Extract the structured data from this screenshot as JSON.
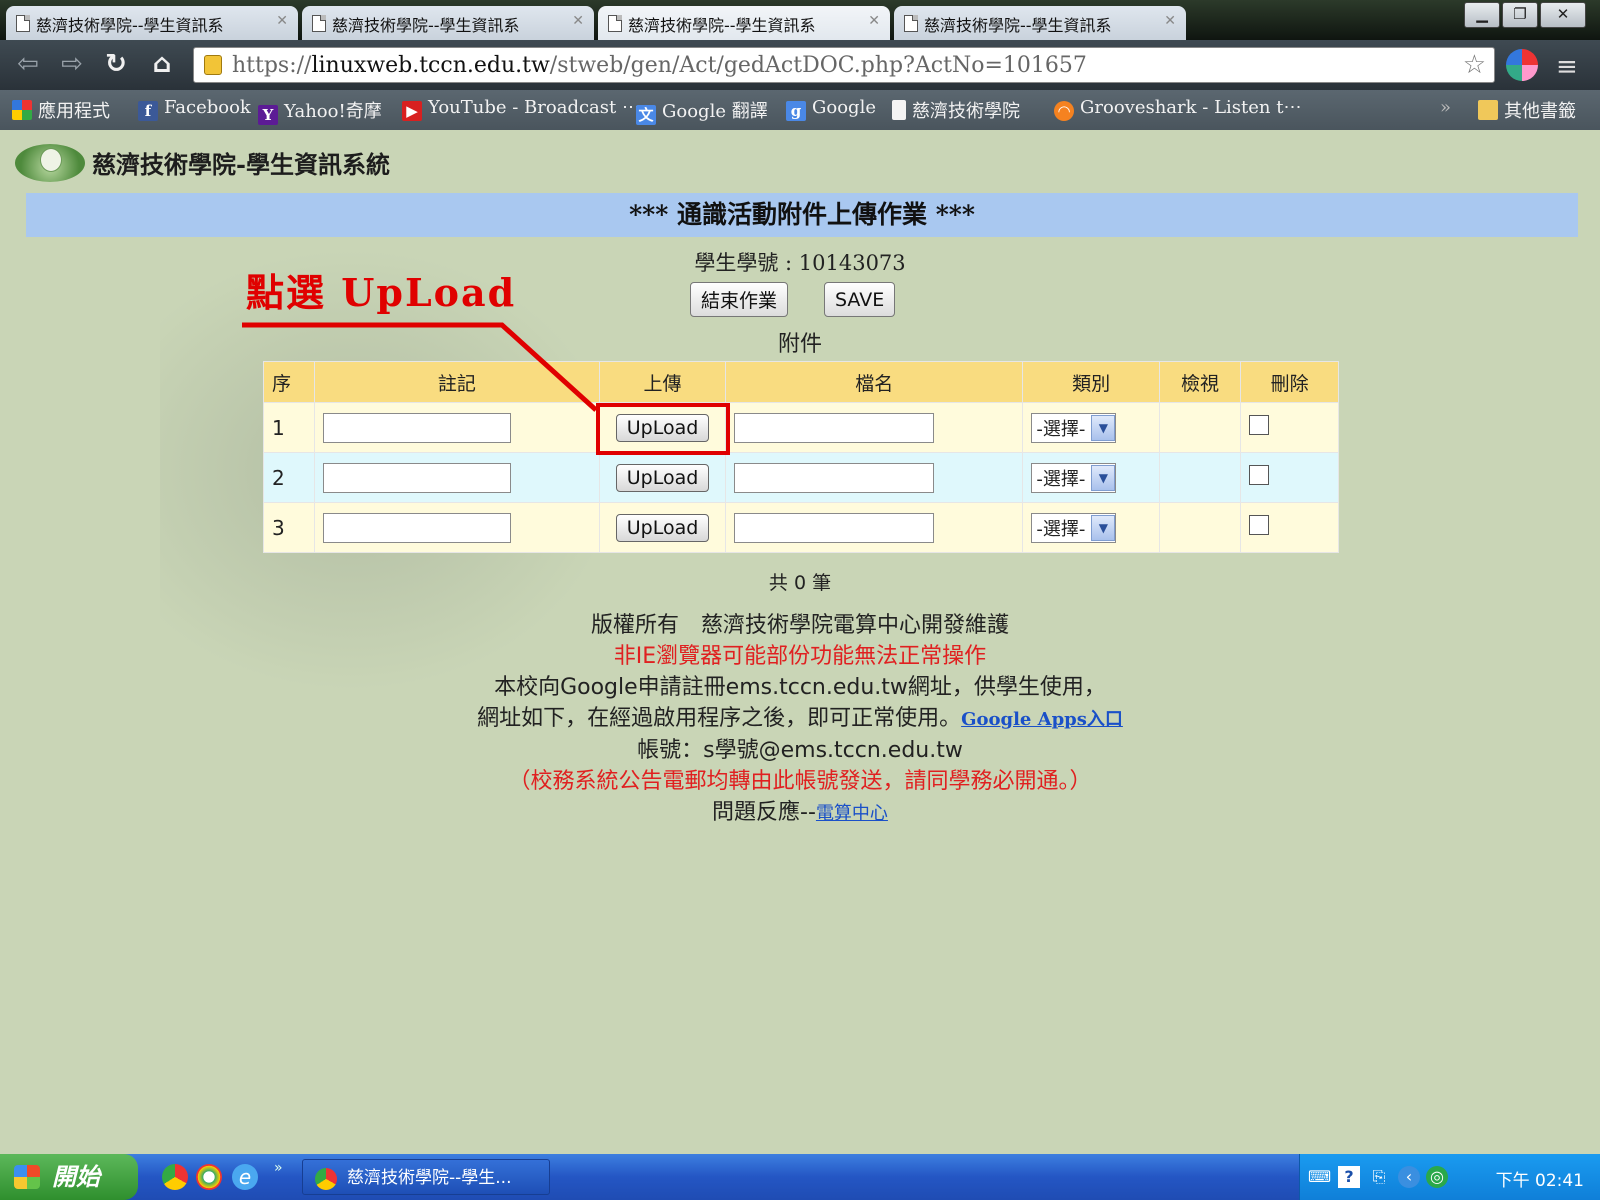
{
  "browser": {
    "tabs": [
      {
        "title": "慈濟技術學院--學生資訊系"
      },
      {
        "title": "慈濟技術學院--學生資訊系"
      },
      {
        "title": "慈濟技術學院--學生資訊系"
      },
      {
        "title": "慈濟技術學院--學生資訊系"
      }
    ],
    "url_prefix": "https://",
    "url_host": "linuxweb.tccn.edu.tw",
    "url_path": "/stweb/gen/Act/gedActDOC.php?ActNo=101657",
    "bookmarks": [
      {
        "label": "應用程式",
        "icon": "apps-icon"
      },
      {
        "label": "Facebook",
        "icon": "facebook-icon"
      },
      {
        "label": "Yahoo!奇摩",
        "icon": "yahoo-icon"
      },
      {
        "label": "YouTube - Broadcast ⋯",
        "icon": "youtube-icon"
      },
      {
        "label": "Google 翻譯",
        "icon": "google-translate-icon"
      },
      {
        "label": "Google",
        "icon": "google-icon"
      },
      {
        "label": "慈濟技術學院",
        "icon": "page-icon"
      },
      {
        "label": "Grooveshark - Listen t⋯",
        "icon": "grooveshark-icon"
      }
    ],
    "overflow_chevron": "»",
    "other_bookmarks": "其他書籤"
  },
  "page": {
    "site_title": "慈濟技術學院-學生資訊系統",
    "banner": "*** 通識活動附件上傳作業 ***",
    "student_id_label": "學生學號 : 10143073",
    "end_button": "結束作業",
    "save_button": "SAVE",
    "attachments_title": "附件",
    "table": {
      "headers": [
        "序",
        "註記",
        "上傳",
        "檔名",
        "類別",
        "檢視",
        "刪除"
      ],
      "rows": [
        {
          "no": "1",
          "upload": "UpLoad",
          "category": "-選擇-"
        },
        {
          "no": "2",
          "upload": "UpLoad",
          "category": "-選擇-"
        },
        {
          "no": "3",
          "upload": "UpLoad",
          "category": "-選擇-"
        }
      ]
    },
    "total": "共 0 筆",
    "footer": {
      "copyright": "版權所有　慈濟技術學院電算中心開發維護",
      "warning": "非IE瀏覽器可能部份功能無法正常操作",
      "line1": "本校向Google申請註冊ems.tccn.edu.tw網址，供學生使用，",
      "line2": "網址如下，在經過啟用程序之後，即可正常使用。",
      "google_apps_link": "Google Apps入口",
      "account": "帳號：s學號@ems.tccn.edu.tw",
      "notice": "（校務系統公告電郵均轉由此帳號發送，請同學務必開通。）",
      "feedback": "問題反應--",
      "feedback_link": "電算中心"
    },
    "annotation": "點選 UpLoad"
  },
  "taskbar": {
    "start": "開始",
    "task": "慈濟技術學院--學生...",
    "clock": "下午 02:41"
  },
  "colors": {
    "banner": "#a9c8f0",
    "header_row": "#f9dc80",
    "annotation": "#e00000",
    "warning_text": "#e02020",
    "page_bg": "#c9d5b6"
  }
}
